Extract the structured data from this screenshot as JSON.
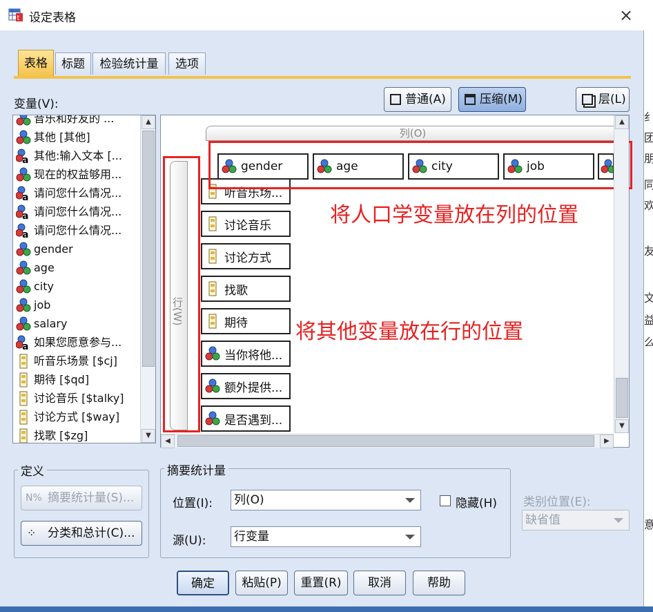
{
  "window": {
    "title": "设定表格",
    "close": "×"
  },
  "tabs": [
    {
      "label": "表格"
    },
    {
      "label": "标题"
    },
    {
      "label": "检验统计量"
    },
    {
      "label": "选项"
    }
  ],
  "variables_label": "变量(V):",
  "view_buttons": {
    "normal": "普通(A)",
    "compact": "压缩(M)",
    "layers": "层(L)"
  },
  "variables": [
    {
      "label": "音乐和好友的 ...",
      "type": "nominal"
    },
    {
      "label": "其他 [其他]",
      "type": "nominal"
    },
    {
      "label": "其他:输入文本 [...",
      "type": "nominal-string"
    },
    {
      "label": "现在的权益够用...",
      "type": "nominal"
    },
    {
      "label": "请问您什么情况...",
      "type": "nominal-string"
    },
    {
      "label": "请问您什么情况...",
      "type": "nominal-string"
    },
    {
      "label": "请问您什么情况...",
      "type": "nominal-string"
    },
    {
      "label": "gender",
      "type": "nominal"
    },
    {
      "label": "age",
      "type": "nominal"
    },
    {
      "label": "city",
      "type": "nominal"
    },
    {
      "label": "job",
      "type": "nominal"
    },
    {
      "label": "salary",
      "type": "nominal"
    },
    {
      "label": "如果您愿意参与...",
      "type": "nominal-string"
    },
    {
      "label": "听音乐场景 [$cj]",
      "type": "mrset"
    },
    {
      "label": "期待 [$qd]",
      "type": "mrset"
    },
    {
      "label": "讨论音乐 [$talky]",
      "type": "mrset"
    },
    {
      "label": "讨论方式 [$way]",
      "type": "mrset"
    },
    {
      "label": "找歌 [$zg]",
      "type": "mrset"
    }
  ],
  "canvas": {
    "column_label": "列(O)",
    "row_label": "行(W)",
    "column_vars": [
      {
        "label": "gender"
      },
      {
        "label": "age"
      },
      {
        "label": "city"
      },
      {
        "label": "job"
      }
    ],
    "row_vars": [
      {
        "label": "听音乐场...",
        "type": "mrset"
      },
      {
        "label": "讨论音乐",
        "type": "mrset"
      },
      {
        "label": "讨论方式",
        "type": "mrset"
      },
      {
        "label": "找歌",
        "type": "mrset"
      },
      {
        "label": "期待",
        "type": "mrset"
      },
      {
        "label": "当你将他...",
        "type": "nominal"
      },
      {
        "label": "额外提供...",
        "type": "nominal"
      },
      {
        "label": "是否遇到...",
        "type": "nominal"
      }
    ],
    "annotation_columns": "将人口学变量放在列的位置",
    "annotation_rows": "将其他变量放在行的位置"
  },
  "define": {
    "legend": "定义",
    "summary_button": "摘要统计量(S)...",
    "category_button": "分类和总计(C)..."
  },
  "summary": {
    "legend": "摘要统计量",
    "position_label": "位置(I):",
    "position_value": "列(O)",
    "hide_label": "隐藏(H)",
    "source_label": "源(U):",
    "source_value": "行变量"
  },
  "category_position": {
    "label": "类别位置(E):",
    "value": "缺省值"
  },
  "footer": {
    "ok": "确定",
    "paste": "粘贴(P)",
    "reset": "重置(R)",
    "cancel": "取消",
    "help": "帮助"
  },
  "right_strip": [
    "纟",
    "团小",
    "朋友",
    "同一",
    "欢新",
    "友的",
    "文",
    "益够",
    "么情",
    "意参"
  ],
  "colors": {
    "accent_tab": "#f3c34d",
    "selected_btn": "#8fb0e0",
    "annotation": "#e62222",
    "dialog_bg": "#dce6f4"
  }
}
